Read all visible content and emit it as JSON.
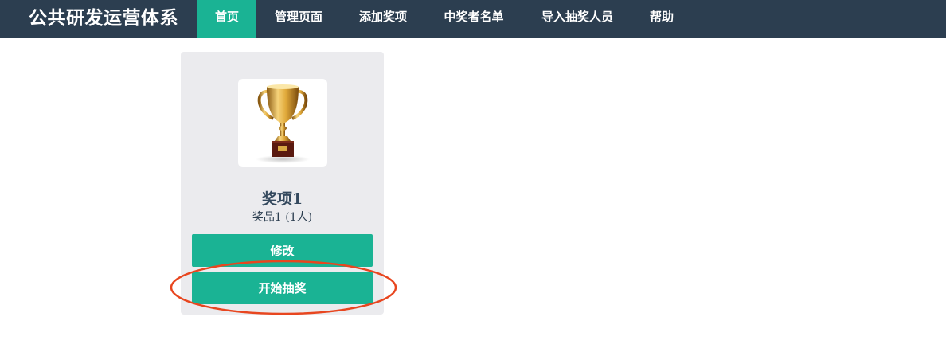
{
  "navbar": {
    "brand": "公共研发运营体系",
    "items": [
      {
        "label": "首页",
        "active": true
      },
      {
        "label": "管理页面",
        "active": false
      },
      {
        "label": "添加奖项",
        "active": false
      },
      {
        "label": "中奖者名单",
        "active": false
      },
      {
        "label": "导入抽奖人员",
        "active": false
      },
      {
        "label": "帮助",
        "active": false
      }
    ]
  },
  "prize_card": {
    "image_icon": "trophy-icon",
    "title": "奖项1",
    "subtitle": "奖品1 (1人)",
    "edit_label": "修改",
    "start_label": "开始抽奖"
  },
  "colors": {
    "navbar_bg": "#2c3e50",
    "accent": "#1ab394",
    "card_bg": "#ebebee",
    "highlight_ring": "#e8461f"
  }
}
